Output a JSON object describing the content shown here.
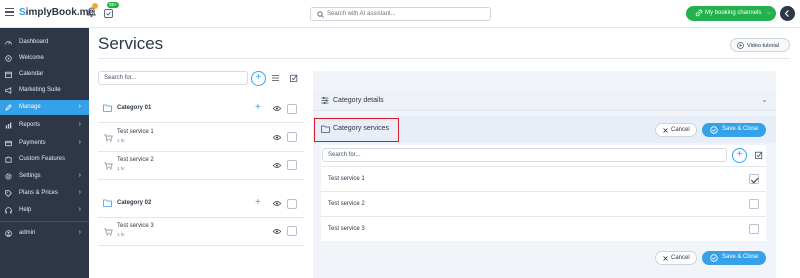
{
  "topbar": {
    "logo_prefix": "S",
    "logo_text": "implyBook.me",
    "notifications_badge": "",
    "calendar_badge": "99+",
    "search_placeholder": "Search with AI assistant...",
    "channels_label": "My booking channels",
    "channels_icon": "link-icon"
  },
  "sidebar": {
    "items": [
      {
        "label": "Dashboard",
        "icon": "dashboard-icon"
      },
      {
        "label": "Welcome",
        "icon": "welcome-icon"
      },
      {
        "label": "Calendar",
        "icon": "calendar-icon"
      },
      {
        "label": "Marketing Suite",
        "icon": "megaphone-icon"
      },
      {
        "label": "Manage",
        "icon": "pencil-icon",
        "active": true
      },
      {
        "label": "Reports",
        "icon": "reports-icon"
      },
      {
        "label": "Payments",
        "icon": "payments-icon"
      },
      {
        "label": "Custom Features",
        "icon": "puzzle-icon"
      },
      {
        "label": "Settings",
        "icon": "gear-icon"
      },
      {
        "label": "Plans & Prices",
        "icon": "plans-icon"
      },
      {
        "label": "Help",
        "icon": "help-icon"
      }
    ],
    "user_label": "admin"
  },
  "main": {
    "title": "Services",
    "video_tutorial_label": "Video tutorial"
  },
  "left_list": {
    "search_placeholder": "Search for...",
    "categories": [
      {
        "name": "Category 01",
        "services": [
          {
            "name": "Test service 1",
            "duration": "1 hr."
          },
          {
            "name": "Test service 2",
            "duration": "1 hr."
          }
        ]
      },
      {
        "name": "Category 02",
        "services": [
          {
            "name": "Test service 3",
            "duration": "1 hr."
          }
        ]
      }
    ]
  },
  "right_panel": {
    "details_label": "Category details",
    "services_label": "Category services",
    "cancel_label": "Cancel",
    "save_label": "Save & Close",
    "search_placeholder": "Search for...",
    "services": [
      {
        "name": "Test service 1",
        "checked": true
      },
      {
        "name": "Test service 2",
        "checked": false
      },
      {
        "name": "Test service 3",
        "checked": false
      }
    ]
  },
  "colors": {
    "accent": "#35a1e8",
    "sidebar_bg": "#2d3748",
    "success": "#22b14c",
    "highlight_box": "#d81b2a"
  }
}
